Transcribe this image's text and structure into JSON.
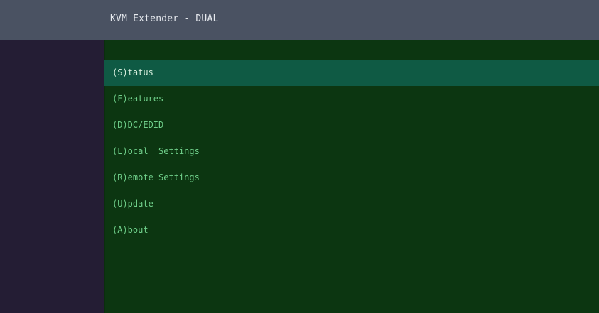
{
  "window": {
    "title": "KVM Extender - DUAL"
  },
  "menu": {
    "selected_index": 0,
    "items": [
      {
        "label": "(S)tatus"
      },
      {
        "label": "(F)eatures"
      },
      {
        "label": "(D)DC/EDID"
      },
      {
        "label": "(L)ocal  Settings"
      },
      {
        "label": "(R)emote Settings"
      },
      {
        "label": "(U)pdate"
      },
      {
        "label": "(A)bout"
      }
    ]
  },
  "colors": {
    "title_bar": "#4a5262",
    "left_panel": "#241d34",
    "main_panel": "#0c3611",
    "selected_row": "#0f5a44",
    "menu_text": "#6fcf8a"
  }
}
